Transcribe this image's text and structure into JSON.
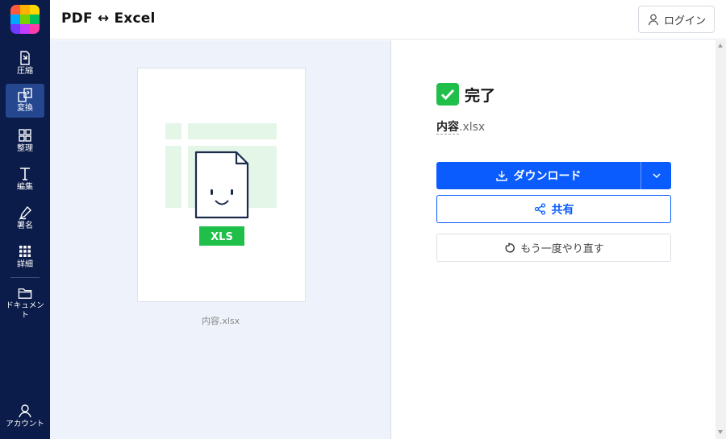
{
  "app": {
    "title": "PDF ↔ Excel"
  },
  "header": {
    "login_label": "ログイン",
    "login_icon": "user-icon"
  },
  "sidebar": {
    "items": [
      {
        "label": "圧縮",
        "icon": "compress-icon"
      },
      {
        "label": "変換",
        "icon": "convert-icon",
        "active": true
      },
      {
        "label": "整理",
        "icon": "organize-icon"
      },
      {
        "label": "編集",
        "icon": "edit-icon"
      },
      {
        "label": "署名",
        "icon": "sign-icon"
      },
      {
        "label": "詳細",
        "icon": "more-icon"
      },
      {
        "label": "ドキュメント",
        "icon": "folder-icon"
      }
    ],
    "account_label": "アカウント"
  },
  "preview": {
    "badge": "XLS",
    "caption": "内容.xlsx"
  },
  "result": {
    "status": "完了",
    "file_base": "内容",
    "file_ext": ".xlsx",
    "download_label": "ダウンロード",
    "share_label": "共有",
    "retry_label": "もう一度やり直す"
  },
  "colors": {
    "sidebar_bg": "#0b1c4a",
    "accent": "#0a5cff",
    "success": "#1fbf4a",
    "badge": "#1fbf4a"
  }
}
